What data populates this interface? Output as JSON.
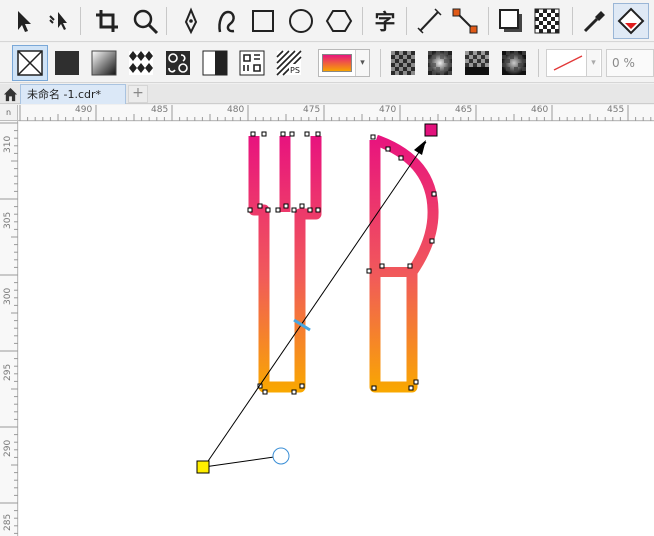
{
  "document": {
    "tab_label": "未命名 -1.cdr*",
    "add_tab_label": "+"
  },
  "toolbar": {
    "text_tool_glyph": "字",
    "tools": [
      {
        "name": "pick-tool-icon"
      },
      {
        "name": "shape-tool-icon"
      },
      {
        "name": "crop-tool-icon"
      },
      {
        "name": "zoom-tool-icon"
      },
      {
        "name": "pen-tool-icon"
      },
      {
        "name": "artistic-media-icon"
      },
      {
        "name": "rectangle-tool-icon"
      },
      {
        "name": "ellipse-tool-icon"
      },
      {
        "name": "polygon-tool-icon"
      },
      {
        "name": "text-tool-icon"
      },
      {
        "name": "parallel-dimension-icon"
      },
      {
        "name": "connector-tool-icon"
      },
      {
        "name": "drop-shadow-icon"
      },
      {
        "name": "transparency-tool-icon"
      },
      {
        "name": "color-eyedropper-icon"
      },
      {
        "name": "interactive-fill-icon"
      }
    ]
  },
  "property_bar": {
    "fill_types": [
      "no-fill",
      "uniform-fill",
      "fountain-fill",
      "vector-pattern-fill",
      "bitmap-pattern-fill",
      "two-color-pattern-fill",
      "texture-fill",
      "postscript-fill"
    ],
    "gradient_colors": [
      "#e8177e",
      "#f7a300"
    ],
    "transparency_buttons": 4,
    "percent_value": "0 %"
  },
  "rulers": {
    "top_labels": [
      "490",
      "485",
      "480",
      "475",
      "470",
      "465",
      "460",
      "455"
    ],
    "left_labels": [
      "310",
      "305",
      "300",
      "295",
      "290",
      "285"
    ],
    "corner_label": "n"
  },
  "artwork": {
    "gradient_start": "#e8127f",
    "gradient_end": "#f9a800",
    "start_handle_color": "#ffee00",
    "end_handle_color": "#e2127c",
    "mid_handle_color": "#4aa6e0"
  }
}
